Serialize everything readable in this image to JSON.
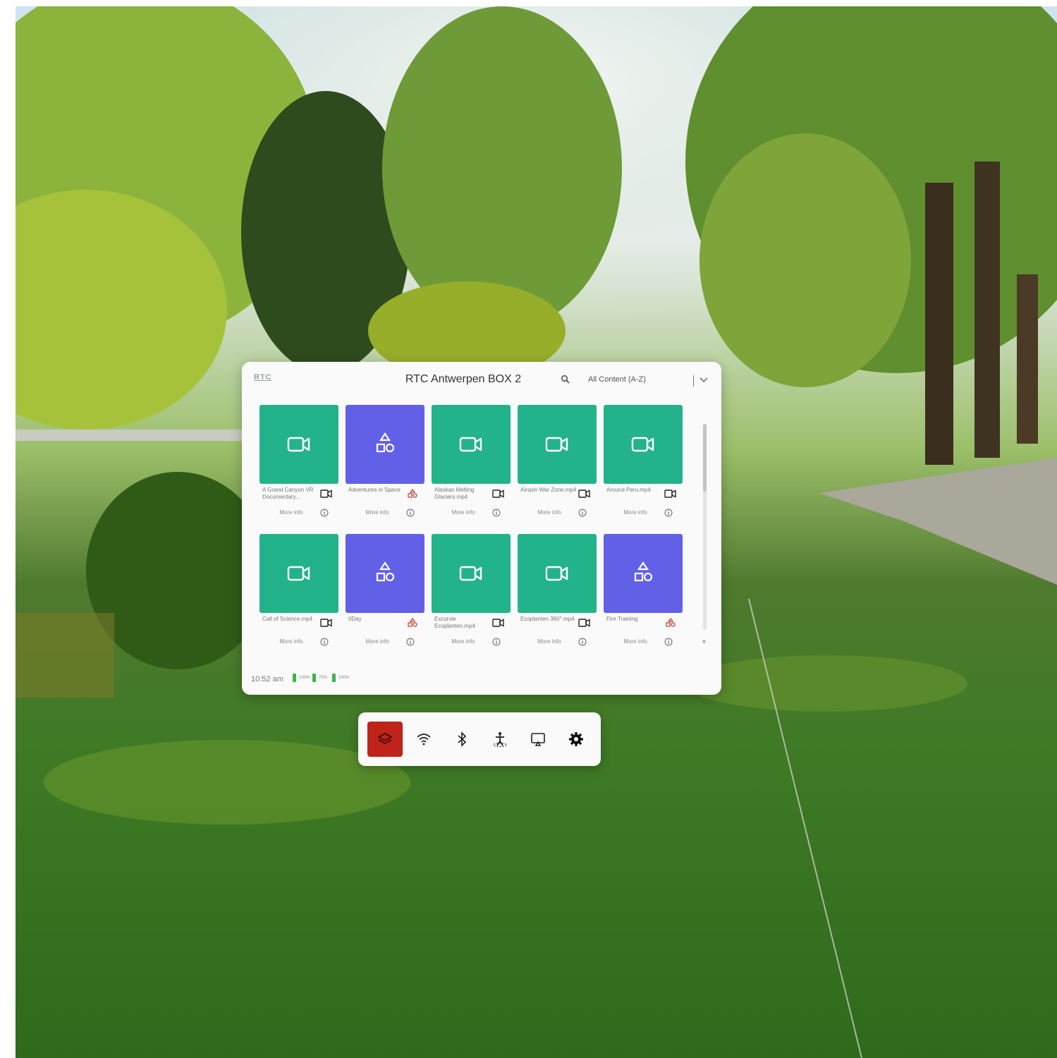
{
  "panel": {
    "logo": "RTC",
    "title": "RTC Antwerpen BOX 2",
    "sort_label": "All Content (A-Z)",
    "time": "10:52 am",
    "battery": [
      "100%",
      "75%",
      "100%"
    ]
  },
  "content": [
    {
      "name": "A Grand Canyon VR Documentary...",
      "type": "video",
      "more": "More info"
    },
    {
      "name": "Adventures in Space",
      "type": "app",
      "more": "More info"
    },
    {
      "name": "Alaskan Melting Glaciers.mp4",
      "type": "video",
      "more": "More info"
    },
    {
      "name": "Airspin War Zone.mp4",
      "type": "video",
      "more": "More info"
    },
    {
      "name": "Around Peru.mp4",
      "type": "video",
      "more": "More info"
    },
    {
      "name": "Call of Science.mp4",
      "type": "video",
      "more": "More info"
    },
    {
      "name": "0Day",
      "type": "app",
      "more": "More info"
    },
    {
      "name": "Excursie Ecoplanten.mp4",
      "type": "video",
      "more": "More info"
    },
    {
      "name": "Ecoplanten 360°.mp4",
      "type": "video",
      "more": "More info"
    },
    {
      "name": "Fire Training",
      "type": "app",
      "more": "More info"
    }
  ],
  "dock": {
    "items": [
      "layers-icon",
      "wifi-icon",
      "bluetooth-icon",
      "boundary-icon",
      "cast-icon",
      "settings-icon"
    ],
    "active": "layers-icon",
    "active_color": "#c0231a"
  },
  "colors": {
    "video_tile": "#23b38b",
    "app_tile": "#6360e8"
  }
}
